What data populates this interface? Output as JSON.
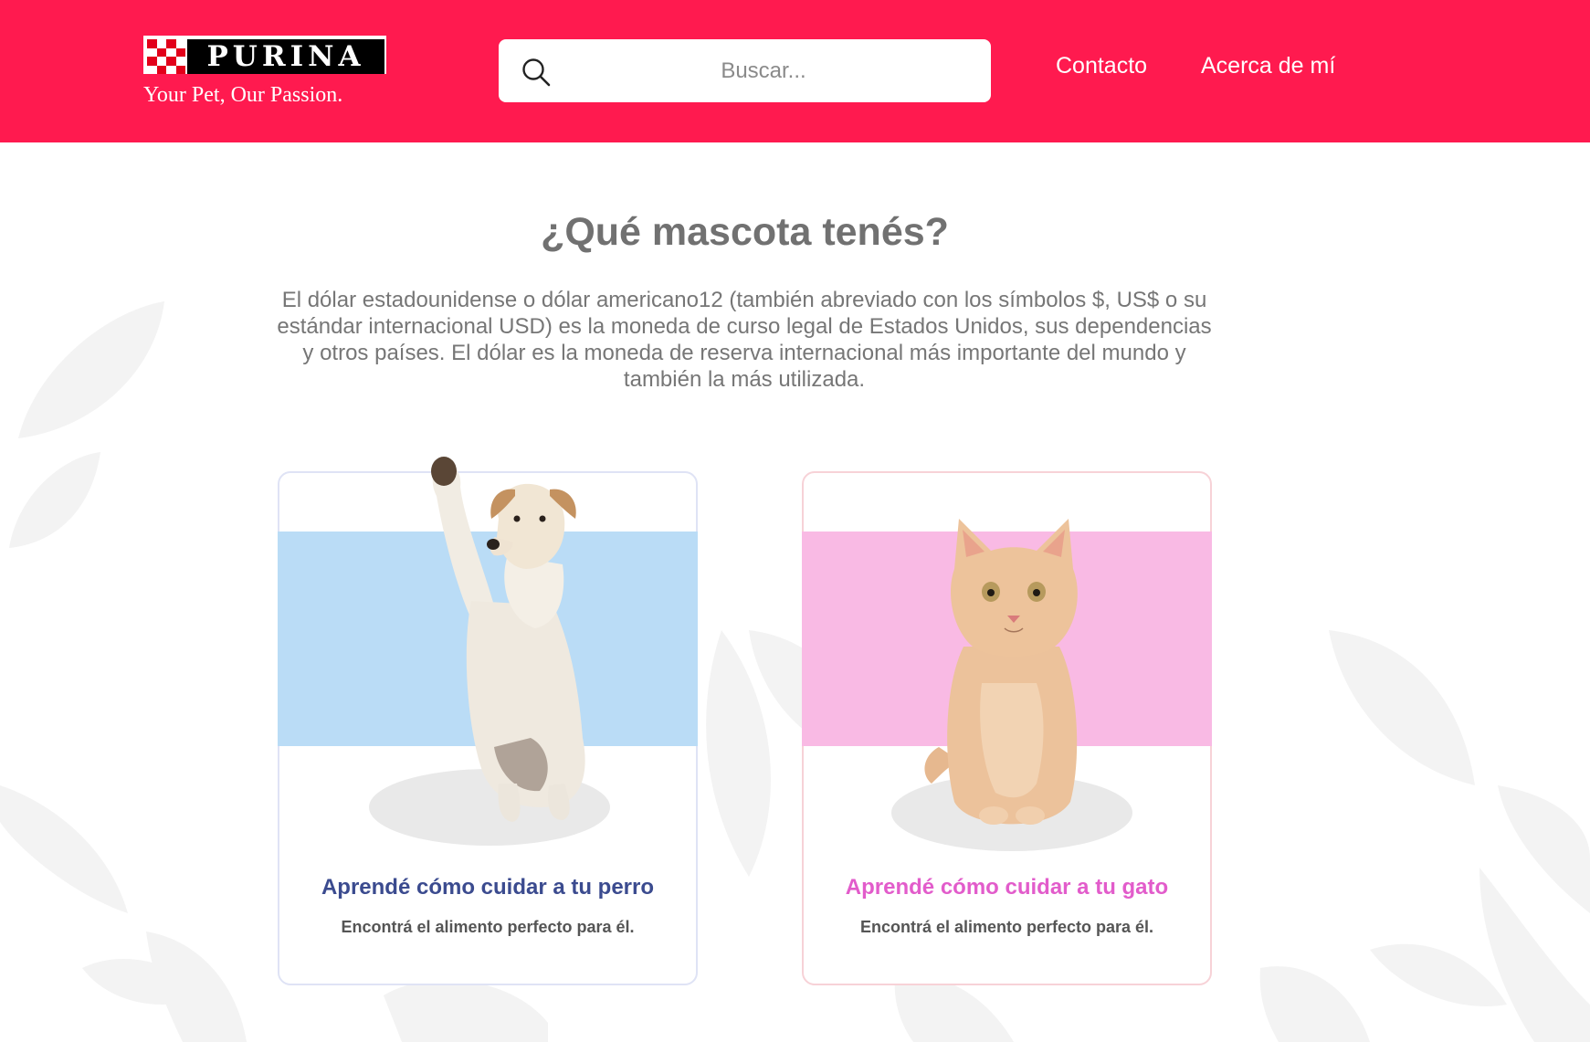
{
  "header": {
    "logo_word": "PURINA",
    "logo_tagline": "Your Pet, Our Passion.",
    "search_placeholder": "Buscar...",
    "nav": {
      "contact": "Contacto",
      "about": "Acerca de mí"
    }
  },
  "main": {
    "title": "¿Qué mascota tenés?",
    "intro": "El dólar estadounidense o dólar americano12 (también abreviado con los símbolos $, US$ o su estándar internacional USD) es la moneda de curso legal de Estados Unidos, sus dependencias y otros países. El dólar es la moneda de reserva internacional más importante del mundo y también la más utilizada."
  },
  "cards": [
    {
      "title": "Aprendé cómo cuidar a tu perro",
      "subtitle": "Encontrá el alimento perfecto para él.",
      "image": "dog-image",
      "accent": "#3b4b8f",
      "band_color": "#badcf6"
    },
    {
      "title": "Aprendé cómo cuidar a tu gato",
      "subtitle": "Encontrá el alimento perfecto para él.",
      "image": "cat-image",
      "accent": "#e25ccb",
      "band_color": "#f9bae4"
    }
  ],
  "colors": {
    "header_bg": "#ff1a4f",
    "text_gray": "#717171"
  }
}
